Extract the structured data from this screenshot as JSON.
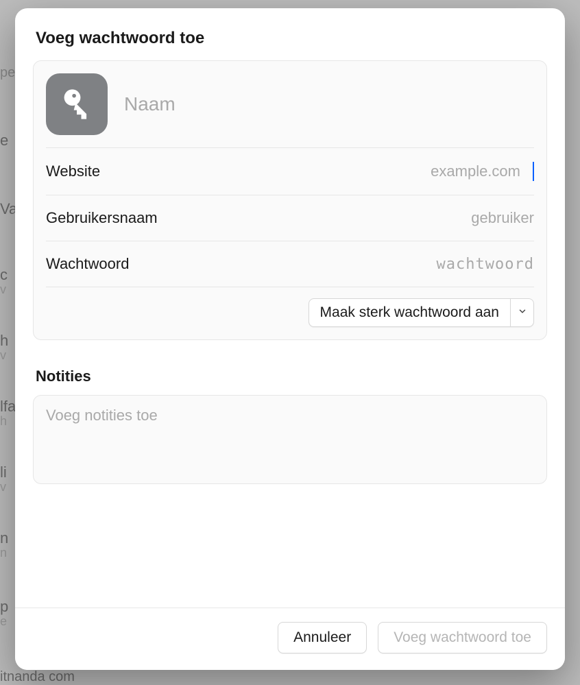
{
  "bg": {
    "a": "e",
    "b": "Va",
    "c": "c",
    "c2": "v",
    "d": "h",
    "d2": "v",
    "e": "lfa",
    "e2": "h",
    "f": "li",
    "f2": "v",
    "g": "n",
    "g2": "n",
    "h": "p",
    "h2": "e",
    "bottom": "itnanda com",
    "search": "pe"
  },
  "modal": {
    "title": "Voeg wachtwoord toe",
    "name_placeholder": "Naam",
    "fields": {
      "website": {
        "label": "Website",
        "placeholder": "example.com",
        "value": ""
      },
      "username": {
        "label": "Gebruikersnaam",
        "placeholder": "gebruiker",
        "value": ""
      },
      "password": {
        "label": "Wachtwoord",
        "placeholder": "wachtwoord",
        "value": ""
      }
    },
    "generate_button": "Maak sterk wachtwoord aan",
    "notes": {
      "heading": "Notities",
      "placeholder": "Voeg notities toe",
      "value": ""
    },
    "footer": {
      "cancel": "Annuleer",
      "submit": "Voeg wachtwoord toe"
    }
  }
}
